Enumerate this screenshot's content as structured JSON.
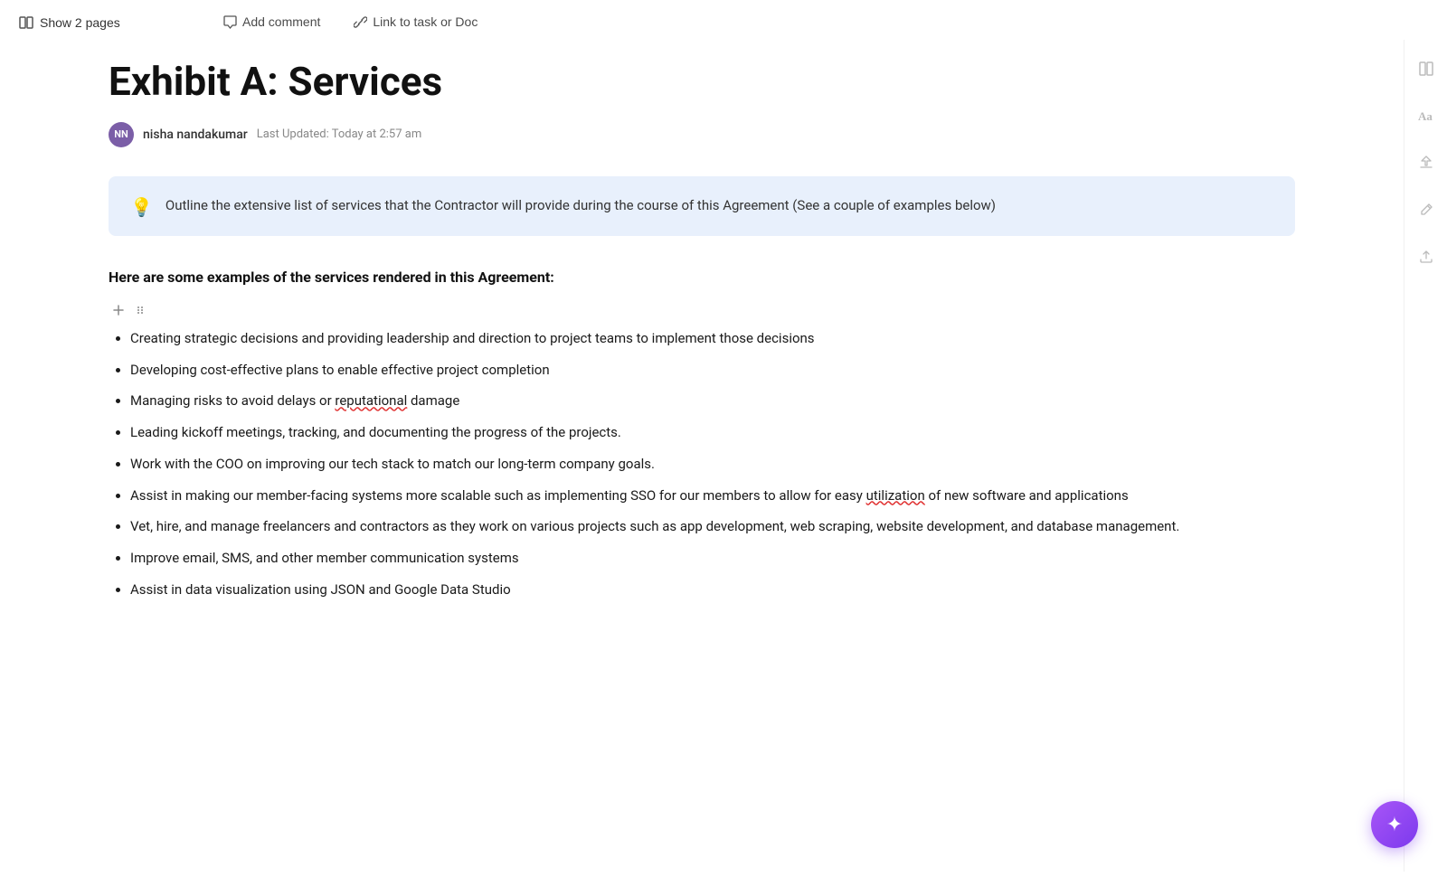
{
  "toolbar": {
    "show_pages_label": "Show 2 pages",
    "add_comment_label": "Add comment",
    "link_to_task_label": "Link to task or Doc"
  },
  "page": {
    "title": "Exhibit A: Services",
    "author": {
      "initials": "NN",
      "name": "nisha nandakumar",
      "last_updated": "Last Updated: Today at 2:57 am"
    },
    "info_box": {
      "icon": "💡",
      "text": "Outline the extensive list of services that the Contractor will provide during the course of this Agreement (See a couple of examples below)"
    },
    "section_heading": "Here are some examples of the services rendered in this Agreement:",
    "list_items": [
      {
        "id": 1,
        "text": "Creating strategic decisions and providing leadership and direction to project teams to implement those decisions"
      },
      {
        "id": 2,
        "text": "Developing cost-effective plans to enable effective project completion"
      },
      {
        "id": 3,
        "text": "Managing risks to avoid delays or reputational damage",
        "underline_word": "reputational"
      },
      {
        "id": 4,
        "text": "Leading kickoff meetings, tracking, and documenting the progress of the projects."
      },
      {
        "id": 5,
        "text": "Work with the COO on improving our tech stack to match our long-term company goals."
      },
      {
        "id": 6,
        "text": "Assist in making our member-facing systems more scalable such as implementing SSO for our members to allow for easy utilization of new software and applications",
        "underline_word": "utilization"
      },
      {
        "id": 7,
        "text": "Vet, hire, and manage freelancers and contractors as they work on various projects such as app development, web scraping, website development, and database management."
      },
      {
        "id": 8,
        "text": "Improve email, SMS, and other member communication systems"
      },
      {
        "id": 9,
        "text": "Assist in data visualization using JSON and Google Data Studio"
      }
    ]
  },
  "right_sidebar": {
    "icons": [
      "layout-icon",
      "text-size-icon",
      "share-icon",
      "edit-icon",
      "upload-icon"
    ]
  },
  "fab": {
    "icon": "✦",
    "label": "AI assistant"
  }
}
